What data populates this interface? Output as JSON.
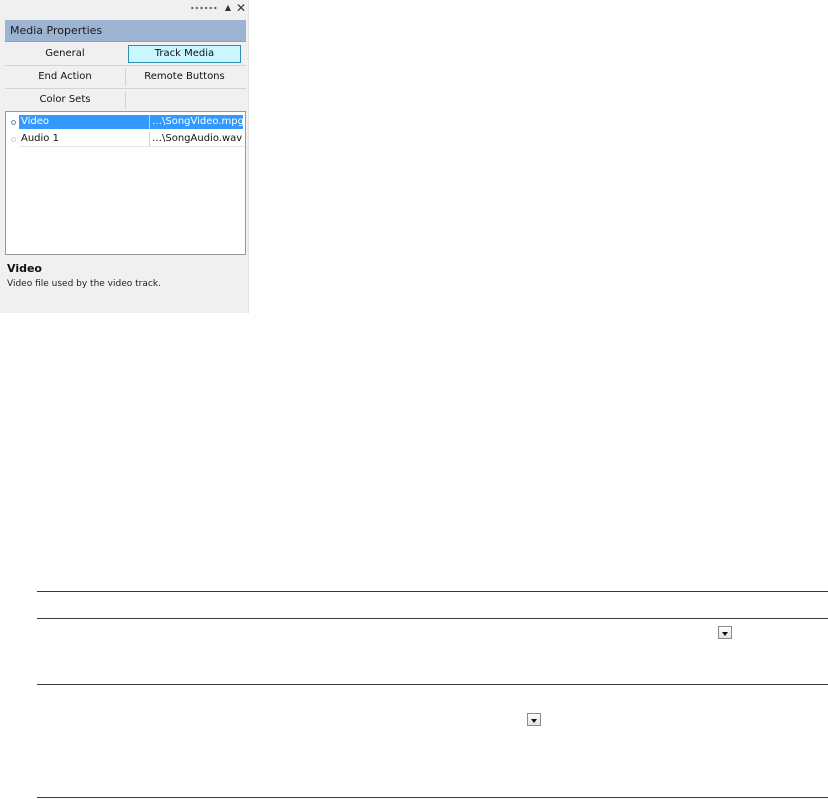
{
  "panel": {
    "title": "Media Properties",
    "window_controls": {
      "grip_icon": "grip-dots-icon",
      "up_icon": "triangle-up-icon",
      "up_glyph": "▲",
      "close_icon": "close-icon",
      "close_glyph": "✕"
    },
    "buttons": {
      "general": "General",
      "track_media": "Track Media",
      "end_action": "End Action",
      "remote_buttons": "Remote Buttons",
      "color_sets": "Color Sets"
    },
    "tracks": [
      {
        "name": "Video",
        "file": "…\\SongVideo.mpg",
        "selected": true
      },
      {
        "name": "Audio 1",
        "file": "…\\SongAudio.wav",
        "selected": false
      }
    ],
    "description": {
      "title": "Video",
      "text": "Video file used by the video track."
    }
  },
  "colors": {
    "title_bar": "#9cb4d2",
    "active_button": "#c9f6ff",
    "active_button_border": "#2d8fb0",
    "selection": "#3399ff"
  },
  "table": {
    "dropdown_icon": "dropdown-arrow-icon"
  }
}
